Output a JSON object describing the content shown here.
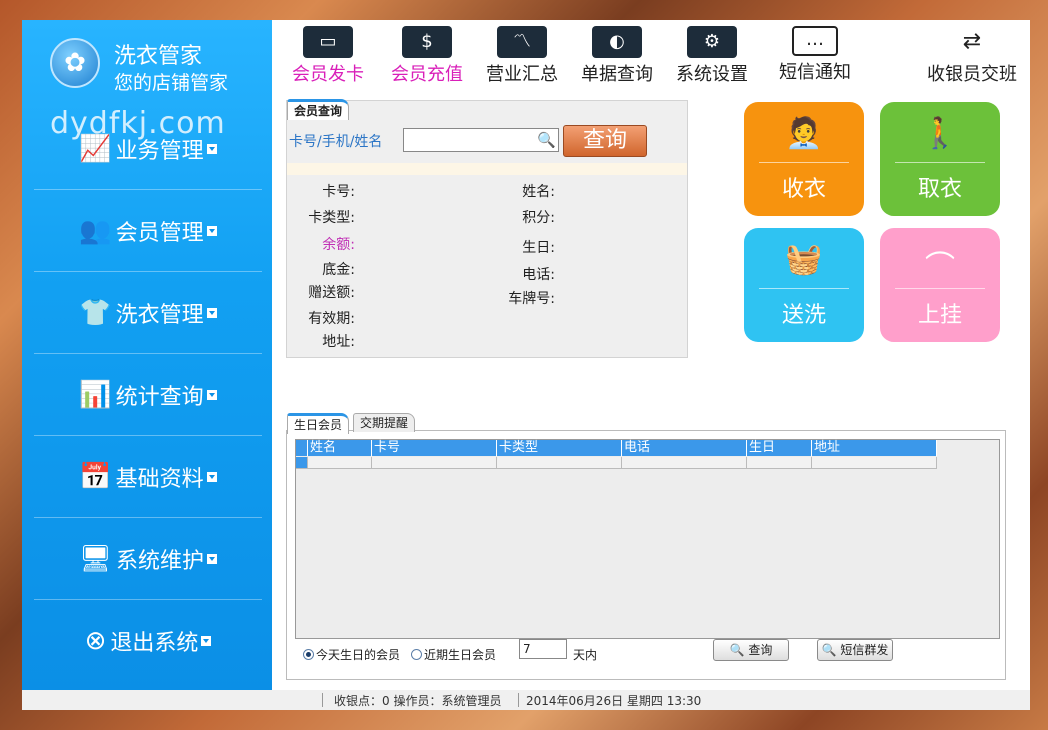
{
  "app": {
    "title_line1": "洗衣管家",
    "title_line2": "您的店铺管家",
    "watermark": "dydfkj.com"
  },
  "sidebar": {
    "items": [
      {
        "label": "业务管理",
        "icon": "trend-chart-icon"
      },
      {
        "label": "会员管理",
        "icon": "users-icon"
      },
      {
        "label": "洗衣管理",
        "icon": "shirt-icon"
      },
      {
        "label": "统计查询",
        "icon": "bar-chart-icon"
      },
      {
        "label": "基础资料",
        "icon": "calendar-icon"
      },
      {
        "label": "系统维护",
        "icon": "monitor-icon"
      },
      {
        "label": "退出系统",
        "icon": "close-circle-icon"
      }
    ]
  },
  "toolbar": {
    "items": [
      {
        "label": "会员发卡",
        "icon": "card-icon",
        "color": "#d91fb9"
      },
      {
        "label": "会员充值",
        "icon": "dollar-card-icon",
        "color": "#d91fb9"
      },
      {
        "label": "营业汇总",
        "icon": "line-chart-icon",
        "color": "#222222"
      },
      {
        "label": "单据查询",
        "icon": "receipt-search-icon",
        "color": "#222222"
      },
      {
        "label": "系统设置",
        "icon": "settings-icon",
        "color": "#222222"
      },
      {
        "label": "短信通知",
        "icon": "message-icon",
        "color": "#222222"
      },
      {
        "label": "收银员交班",
        "icon": "cashier-handover-icon",
        "color": "#222222"
      }
    ]
  },
  "member_query": {
    "tab_label": "会员查询",
    "search_label": "卡号/手机/姓名",
    "search_value": "",
    "search_button": "查询",
    "fields_left": [
      "卡号:",
      "卡类型:",
      "余额:",
      "底金:",
      "赠送额:",
      "有效期:",
      "地址:"
    ],
    "fields_right": [
      "姓名:",
      "积分:",
      "生日:",
      "电话:",
      "车牌号:"
    ]
  },
  "actions": [
    {
      "label": "收衣",
      "icon": "counter-service-icon",
      "color": "#f7930e"
    },
    {
      "label": "取衣",
      "icon": "pickup-person-icon",
      "color": "#6cc13a"
    },
    {
      "label": "送洗",
      "icon": "washer-basket-icon",
      "color": "#2fc3f2"
    },
    {
      "label": "上挂",
      "icon": "hanger-icon",
      "color": "#ff9fcb"
    }
  ],
  "birthday": {
    "tabs": [
      "生日会员",
      "交期提醒"
    ],
    "columns": [
      "姓名",
      "卡号",
      "卡类型",
      "电话",
      "生日",
      "地址"
    ],
    "rows": [],
    "radio_today": "今天生日的会员",
    "radio_upcoming": "近期生日会员",
    "days_value": "7",
    "days_unit": "天内",
    "query_button": "查询",
    "sms_button": "短信群发"
  },
  "status": {
    "station_operator": "收银点：0  操作员：系统管理员",
    "datetime": "2014年06月26日 星期四 13:30"
  }
}
